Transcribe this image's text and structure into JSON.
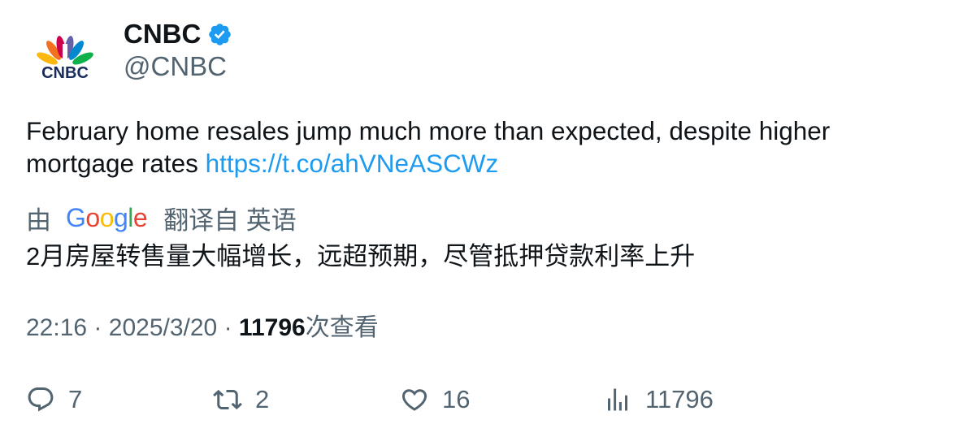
{
  "account": {
    "display_name": "CNBC",
    "handle": "@CNBC",
    "avatar_logo_text": "CNBC",
    "verified_badge_color": "#1d9bf0"
  },
  "tweet": {
    "text": "February home resales jump much more than expected, despite higher mortgage rates",
    "link": "https://t.co/ahVNeASCWz"
  },
  "translation": {
    "prefix": "由",
    "provider": "Google",
    "suffix": "翻译自 英语",
    "text": "2月房屋转售量大幅增长，远超预期，尽管抵押贷款利率上升"
  },
  "meta": {
    "time": "22:16",
    "date": "2025/3/20",
    "separator": "·",
    "views": "11796",
    "views_label": "次查看"
  },
  "actions": {
    "replies": "7",
    "retweets": "2",
    "likes": "16",
    "views": "11796"
  },
  "colors": {
    "text": "#0f1419",
    "secondary": "#536471",
    "link": "#1d9bf0"
  }
}
